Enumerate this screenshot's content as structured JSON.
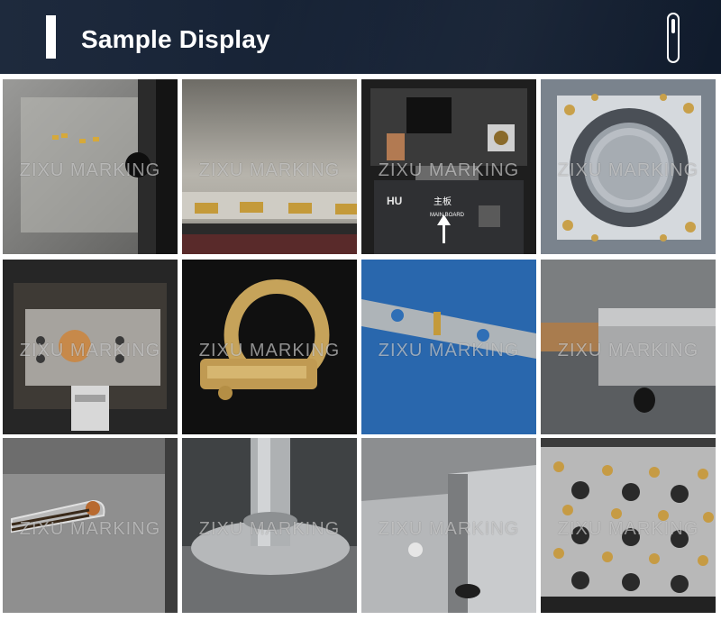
{
  "header": {
    "title": "Sample Display"
  },
  "watermark": "ZIXU MARKING",
  "tiles": [
    {
      "id": "tile-1",
      "watermark": "ZIXU MARKING"
    },
    {
      "id": "tile-2",
      "watermark": "ZIXU MARKING"
    },
    {
      "id": "tile-3",
      "watermark": "ZIXU MARKING",
      "texts": {
        "brand": "HU",
        "board_cn": "主板",
        "board_en": "MAIN BOARD"
      }
    },
    {
      "id": "tile-4",
      "watermark": "ZIXU MARKING"
    },
    {
      "id": "tile-5",
      "watermark": "ZIXU MARKING"
    },
    {
      "id": "tile-6",
      "watermark": "ZIXU MARKING"
    },
    {
      "id": "tile-7",
      "watermark": "ZIXU MARKING"
    },
    {
      "id": "tile-8",
      "watermark": "ZIXU MARKING"
    },
    {
      "id": "tile-9",
      "watermark": "ZIXU MARKING"
    },
    {
      "id": "tile-10",
      "watermark": "ZIXU MARKING"
    },
    {
      "id": "tile-11",
      "watermark": "ZIXU MARKING"
    },
    {
      "id": "tile-12",
      "watermark": "ZIXU MARKING"
    }
  ],
  "colors": {
    "header_bg": "#1a2538",
    "title": "#ffffff"
  }
}
